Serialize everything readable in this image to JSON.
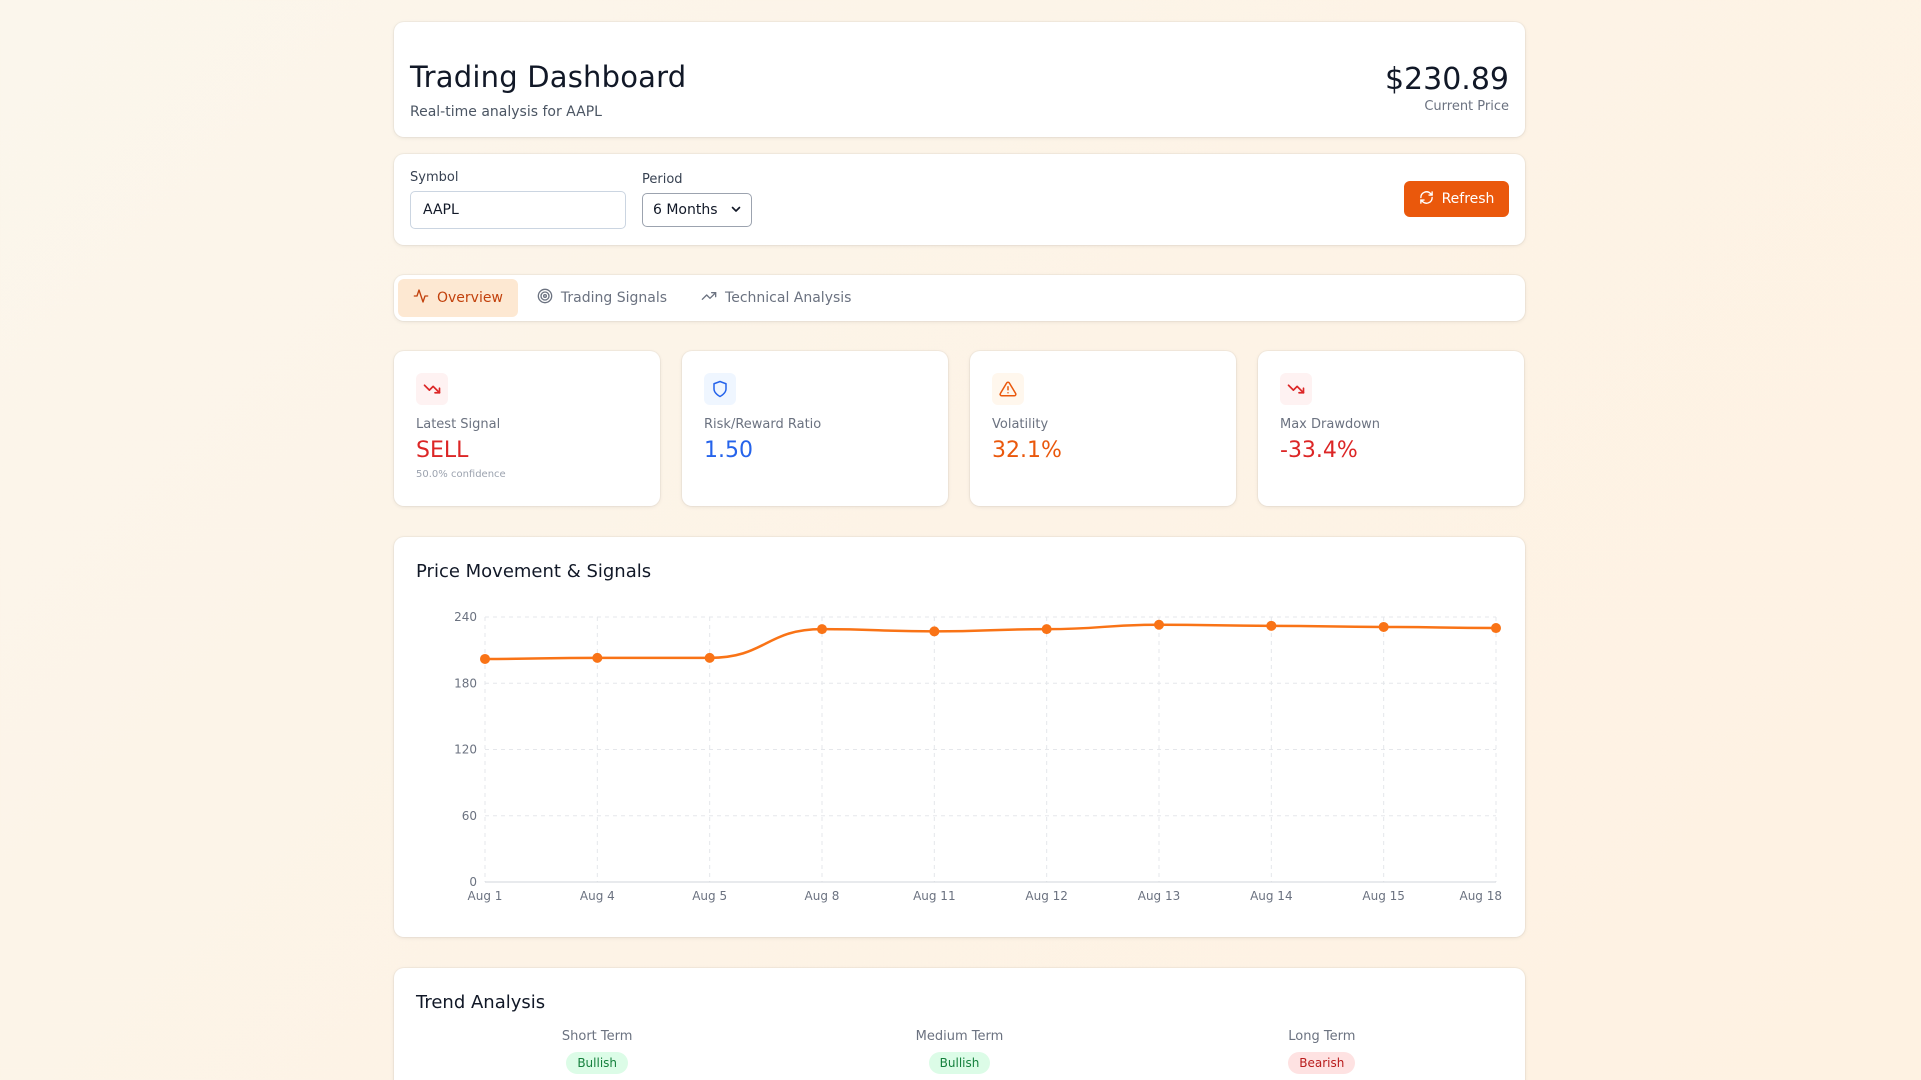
{
  "header": {
    "title": "Trading Dashboard",
    "subtitle": "Real-time analysis for AAPL",
    "price": "$230.89",
    "price_label": "Current Price"
  },
  "controls": {
    "symbol_label": "Symbol",
    "symbol_value": "AAPL",
    "period_label": "Period",
    "period_value": "6 Months",
    "refresh_label": "Refresh"
  },
  "tabs": [
    {
      "label": "Overview",
      "icon": "activity-icon",
      "active": true
    },
    {
      "label": "Trading Signals",
      "icon": "target-icon",
      "active": false
    },
    {
      "label": "Technical Analysis",
      "icon": "trending-up-icon",
      "active": false
    }
  ],
  "metrics": [
    {
      "label": "Latest Signal",
      "value": "SELL",
      "sub": "50.0% confidence",
      "icon": "trending-down-icon",
      "color": "#dc2626"
    },
    {
      "label": "Risk/Reward Ratio",
      "value": "1.50",
      "sub": "",
      "icon": "shield-icon",
      "color": "#2563eb"
    },
    {
      "label": "Volatility",
      "value": "32.1%",
      "sub": "",
      "icon": "alert-triangle-icon",
      "color": "#ea580c"
    },
    {
      "label": "Max Drawdown",
      "value": "-33.4%",
      "sub": "",
      "icon": "trending-down-icon",
      "color": "#dc2626"
    }
  ],
  "chart_data": {
    "type": "line",
    "title": "Price Movement & Signals",
    "categories": [
      "Aug 1",
      "Aug 4",
      "Aug 5",
      "Aug 8",
      "Aug 11",
      "Aug 12",
      "Aug 13",
      "Aug 14",
      "Aug 15",
      "Aug 18"
    ],
    "series": [
      {
        "values": [
          202,
          203,
          203,
          229,
          227,
          229,
          233,
          232,
          231,
          230
        ],
        "color": "#f97316"
      }
    ],
    "yticks": [
      0,
      60,
      120,
      180,
      240
    ],
    "ylim": [
      0,
      240
    ],
    "grid": true
  },
  "trend": {
    "title": "Trend Analysis",
    "items": [
      {
        "label": "Short Term",
        "value": "Bullish",
        "kind": "bull"
      },
      {
        "label": "Medium Term",
        "value": "Bullish",
        "kind": "bull"
      },
      {
        "label": "Long Term",
        "value": "Bearish",
        "kind": "bear"
      }
    ]
  },
  "colors": {
    "accent": "#ea580c",
    "chart_line": "#f97316"
  }
}
